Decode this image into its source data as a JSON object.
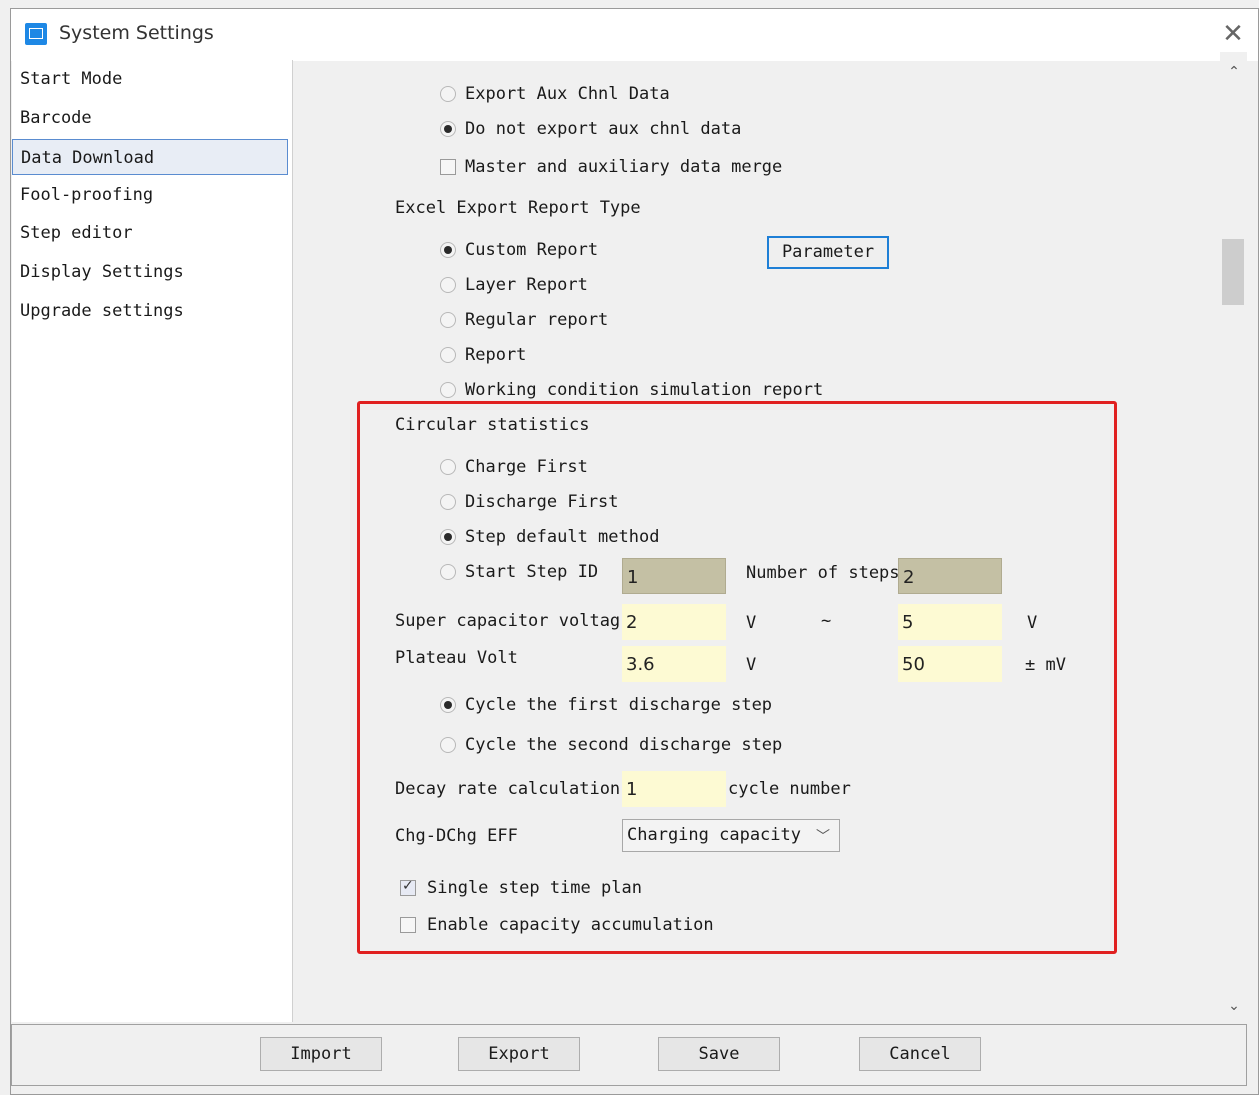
{
  "window": {
    "title": "System Settings",
    "close_glyph": "✕"
  },
  "sidebar": {
    "items": [
      {
        "label": "Start Mode"
      },
      {
        "label": "Barcode"
      },
      {
        "label": "Data Download",
        "selected": true
      },
      {
        "label": "Fool-proofing"
      },
      {
        "label": "Step editor"
      },
      {
        "label": "Display Settings"
      },
      {
        "label": "Upgrade settings"
      }
    ]
  },
  "aux_export": {
    "options": [
      {
        "label": "Export Aux Chnl Data",
        "selected": false
      },
      {
        "label": "Do not export aux chnl data",
        "selected": true
      }
    ],
    "merge_label": "Master and auxiliary data merge",
    "merge_checked": false
  },
  "excel_report": {
    "heading": "Excel Export Report Type",
    "options": [
      {
        "label": "Custom Report",
        "selected": true
      },
      {
        "label": "Layer Report",
        "selected": false
      },
      {
        "label": "Regular report",
        "selected": false
      },
      {
        "label": "Report",
        "selected": false
      },
      {
        "label": "Working condition simulation report",
        "selected": false
      }
    ],
    "parameter_button": "Parameter"
  },
  "circular": {
    "heading": "Circular statistics",
    "options": [
      {
        "label": "Charge First",
        "selected": false
      },
      {
        "label": "Discharge First",
        "selected": false
      },
      {
        "label": "Step default method",
        "selected": true
      },
      {
        "label": "Start Step ID",
        "selected": false
      }
    ],
    "start_step_id": "1",
    "number_of_steps_label": "Number of steps",
    "number_of_steps": "2",
    "super_cap_label": "Super capacitor voltage",
    "super_cap_min": "2",
    "super_cap_max": "5",
    "unit_v": "V",
    "tilde": "~",
    "plateau_label": "Plateau Volt",
    "plateau_value": "3.6",
    "plateau_tol": "50",
    "tol_unit": "± mV",
    "cycle_options": [
      {
        "label": "Cycle the first discharge step",
        "selected": true
      },
      {
        "label": "Cycle the second discharge step",
        "selected": false
      }
    ],
    "decay_label": "Decay rate calculation",
    "decay_value": "1",
    "decay_suffix": "cycle number",
    "eff_label": "Chg-DChg EFF",
    "eff_selected": "Charging capacity",
    "single_step_label": "Single step time plan",
    "single_step_checked": true,
    "enable_accum_label": "Enable capacity accumulation",
    "enable_accum_checked": false
  },
  "footer": {
    "import": "Import",
    "export": "Export",
    "save": "Save",
    "cancel": "Cancel"
  },
  "colors": {
    "highlight": "#e02020",
    "selection_border": "#5a8cd0",
    "input_yellow": "#fdfad3",
    "input_disabled": "#c4c0a4"
  }
}
